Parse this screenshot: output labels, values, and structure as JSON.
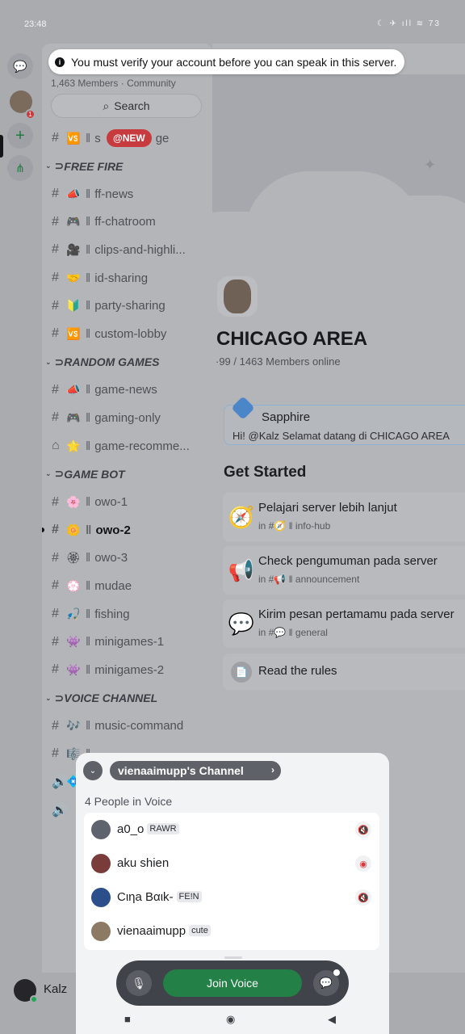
{
  "status": {
    "time": "23:48",
    "right_icons": "☾ ✈ ıll ≋ 73"
  },
  "toast": {
    "text": "You must verify your account before you can speak in this server."
  },
  "rail": {
    "badge": "1"
  },
  "sidebar": {
    "members": "1,463 Members",
    "community": "Community",
    "search": "Search",
    "new_pill": "@NEW",
    "top_row": {
      "emoji": "🆚",
      "name": "s",
      "name_tail": "ge"
    },
    "categories": [
      {
        "name": "FREE FIRE",
        "channels": [
          {
            "icon": "#",
            "emoji": "📣",
            "name": "ff-news"
          },
          {
            "icon": "#",
            "emoji": "🎮",
            "name": "ff-chatroom"
          },
          {
            "icon": "#",
            "emoji": "🎥",
            "name": "clips-and-highli..."
          },
          {
            "icon": "#",
            "emoji": "🤝",
            "name": "id-sharing"
          },
          {
            "icon": "#",
            "emoji": "🔰",
            "name": "party-sharing"
          },
          {
            "icon": "#",
            "emoji": "🆚",
            "name": "custom-lobby"
          }
        ]
      },
      {
        "name": "RANDOM GAMES",
        "channels": [
          {
            "icon": "#",
            "emoji": "📣",
            "name": "game-news"
          },
          {
            "icon": "#",
            "emoji": "🎮",
            "name": "gaming-only"
          },
          {
            "icon": "⌂",
            "emoji": "🌟",
            "name": "game-recomme..."
          }
        ]
      },
      {
        "name": "GAME BOT",
        "channels": [
          {
            "icon": "#",
            "emoji": "🌸",
            "name": "owo-1"
          },
          {
            "icon": "#",
            "emoji": "🌼",
            "name": "owo-2",
            "active": true
          },
          {
            "icon": "#",
            "emoji": "🏵",
            "name": "owo-3"
          },
          {
            "icon": "#",
            "emoji": "💮",
            "name": "mudae"
          },
          {
            "icon": "#",
            "emoji": "🎣",
            "name": "fishing"
          },
          {
            "icon": "#",
            "emoji": "👾",
            "name": "minigames-1"
          },
          {
            "icon": "#",
            "emoji": "👾",
            "name": "minigames-2"
          }
        ]
      },
      {
        "name": "VOICE CHANNEL",
        "channels": [
          {
            "icon": "#",
            "emoji": "🎶",
            "name": "music-command"
          },
          {
            "icon": "#",
            "emoji": "🎼",
            "name": ""
          },
          {
            "icon": "🔊",
            "emoji": "💠",
            "name": ""
          },
          {
            "icon": "🔊",
            "emoji": "",
            "name": "vi"
          }
        ]
      }
    ]
  },
  "server": {
    "name": "CHICAGO AREA",
    "online": "·99 / 1463 Members online",
    "sapphire_name": "Sapphire",
    "sapphire_msg": "Hi! @Kalz Selamat datang di CHICAGO AREA",
    "get_started": "Get Started",
    "cards": [
      {
        "icon": "🧭",
        "title": "Pelajari server lebih lanjut",
        "sub": "in #🧭 ‖ info-hub"
      },
      {
        "icon": "📢",
        "title": "Check pengumuman pada server",
        "sub": "in #📢 ‖ announcement"
      },
      {
        "icon": "💬",
        "title": "Kirim pesan pertamamu pada server",
        "sub": "in #💬 ‖ general"
      }
    ],
    "rules": "Read the rules"
  },
  "user": {
    "name": "Kalz"
  },
  "voice": {
    "channel": "vienaaimupp's Channel",
    "count": "4 People in Voice",
    "people": [
      {
        "name": "a0_o",
        "tag": "RAWR",
        "avatar": "#5e636e",
        "state": "deafen"
      },
      {
        "name": "aku shien",
        "tag": "",
        "avatar": "#7a3b3b",
        "state": "red"
      },
      {
        "name": "Cιηa Bαιk-",
        "tag": "FE!N",
        "avatar": "#2c4e8a",
        "state": "deafen"
      },
      {
        "name": "vienaaimupp",
        "tag": "cute",
        "avatar": "#8c7a64",
        "state": ""
      }
    ],
    "join": "Join Voice"
  }
}
